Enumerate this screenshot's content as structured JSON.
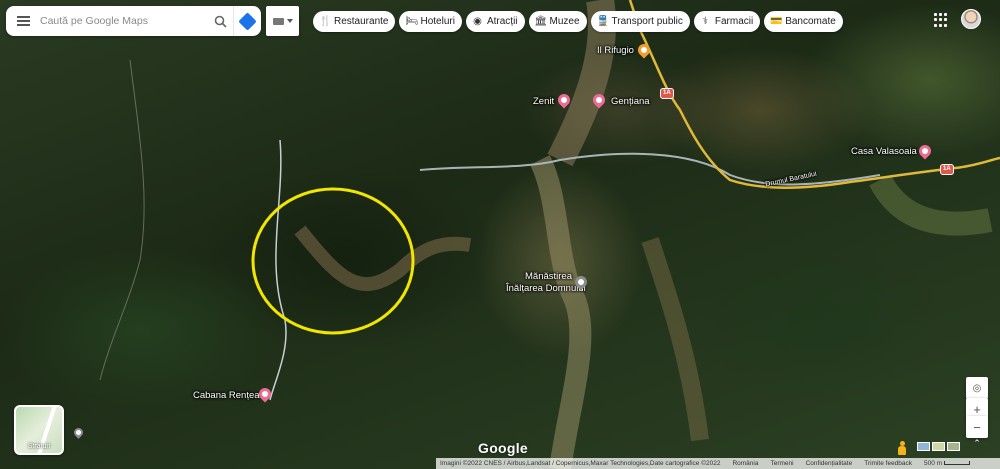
{
  "search": {
    "placeholder": "Caută pe Google Maps"
  },
  "chips": [
    {
      "label": "Restaurante",
      "icon": "fork-knife-icon",
      "glyph": "🍴"
    },
    {
      "label": "Hoteluri",
      "icon": "bed-icon",
      "glyph": "🛏"
    },
    {
      "label": "Atracții",
      "icon": "camera-icon",
      "glyph": "◉"
    },
    {
      "label": "Muzee",
      "icon": "museum-icon",
      "glyph": "🏛"
    },
    {
      "label": "Transport public",
      "icon": "train-icon",
      "glyph": "🚆"
    },
    {
      "label": "Farmacii",
      "icon": "pharmacy-icon",
      "glyph": "⚕"
    },
    {
      "label": "Bancomate",
      "icon": "atm-icon",
      "glyph": "💳"
    }
  ],
  "places": {
    "il_rifugio": "Il Rifugio",
    "zenit": "Zenit",
    "gentiana": "Gențiana",
    "casa_valasoaia": "Casa Valasoaia",
    "manastirea_line1": "Mănăstirea",
    "manastirea_line2": "Înălțarea Domnului",
    "cabana_rentea": "Cabana Rențea",
    "road_label": "Drumul Baratului"
  },
  "road_signs": [
    "1A",
    "1A"
  ],
  "layers": {
    "label": "Straturi"
  },
  "google": "Google",
  "footer": {
    "imagery": "Imagini ©2022 CNES / Airbus,Landsat / Copernicus,Maxar Technologies,Date cartografice ©2022",
    "romania": "România",
    "terms": "Termeni",
    "privacy": "Confidențialitate",
    "feedback": "Trimite feedback",
    "scale": "500 m"
  },
  "colors": {
    "highlight_circle": "#f2e600",
    "accent_blue": "#1a73e8"
  }
}
